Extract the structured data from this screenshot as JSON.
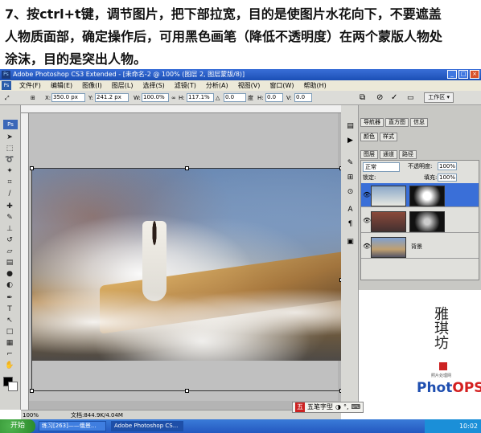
{
  "caption": {
    "line1": "7、按ctrl+t键，调节图片，把下部拉宽，目的是使图片水花向下，不要遮盖",
    "line2": "人物质面部，确定操作后，可用黑色画笔（降低不透明度）在两个蒙版人物处",
    "line3": "涂沫，目的是突出人物。"
  },
  "window": {
    "title": "Adobe Photoshop CS3 Extended - [未命名-2 @ 100% (图层 2, 图层蒙版/8)]",
    "ps_mini": "Ps",
    "min": "_",
    "max": "□",
    "close": "×"
  },
  "menu": {
    "ps_icon": "Ps",
    "items": [
      "文件(F)",
      "编辑(E)",
      "图像(I)",
      "图层(L)",
      "选择(S)",
      "滤镜(T)",
      "分析(A)",
      "视图(V)",
      "窗口(W)",
      "帮助(H)"
    ]
  },
  "options": {
    "x_label": "X:",
    "x_value": "350.0 px",
    "y_label": "Y:",
    "y_value": "241.2 px",
    "w_label": "W:",
    "w_value": "100.0%",
    "h_label": "H:",
    "h_value": "117.1%",
    "rot_value": "0.0",
    "rot_unit": "度",
    "hskew_label": "H:",
    "hskew_value": "0.0",
    "vskew_label": "V:",
    "vskew_value": "0.0",
    "workspace": "工作区 ▾"
  },
  "toolbox": {
    "logo": "Ps"
  },
  "status": {
    "zoom": "100%",
    "doc": "文档:844.9K/4.04M"
  },
  "panels": {
    "tabs_row1": [
      "导航器",
      "直方图",
      "信息"
    ],
    "tabs_row2": [
      "颜色",
      "样式"
    ],
    "tabs_row3": [
      "图层",
      "通道",
      "路径"
    ],
    "blend_mode": "正常",
    "opacity_label": "不透明度:",
    "opacity_value": "100%",
    "lock_label": "锁定:",
    "fill_label": "填充:",
    "fill_value": "100%",
    "background_layer": "背景"
  },
  "logo": {
    "signature": "雅琪坊",
    "sub": "照片处理网",
    "brand": "PhotOPS"
  },
  "ime": {
    "name": "五笔字型",
    "icon": "五"
  },
  "taskbar": {
    "start": "开始",
    "tasks": [
      "练习[263]——俄景...",
      "Adobe Photoshop CS..."
    ],
    "clock": "10:02"
  },
  "colors": {
    "titlebar": "#2558c0",
    "brand_red": "#d42020",
    "brand_blue": "#1f4fb0"
  }
}
